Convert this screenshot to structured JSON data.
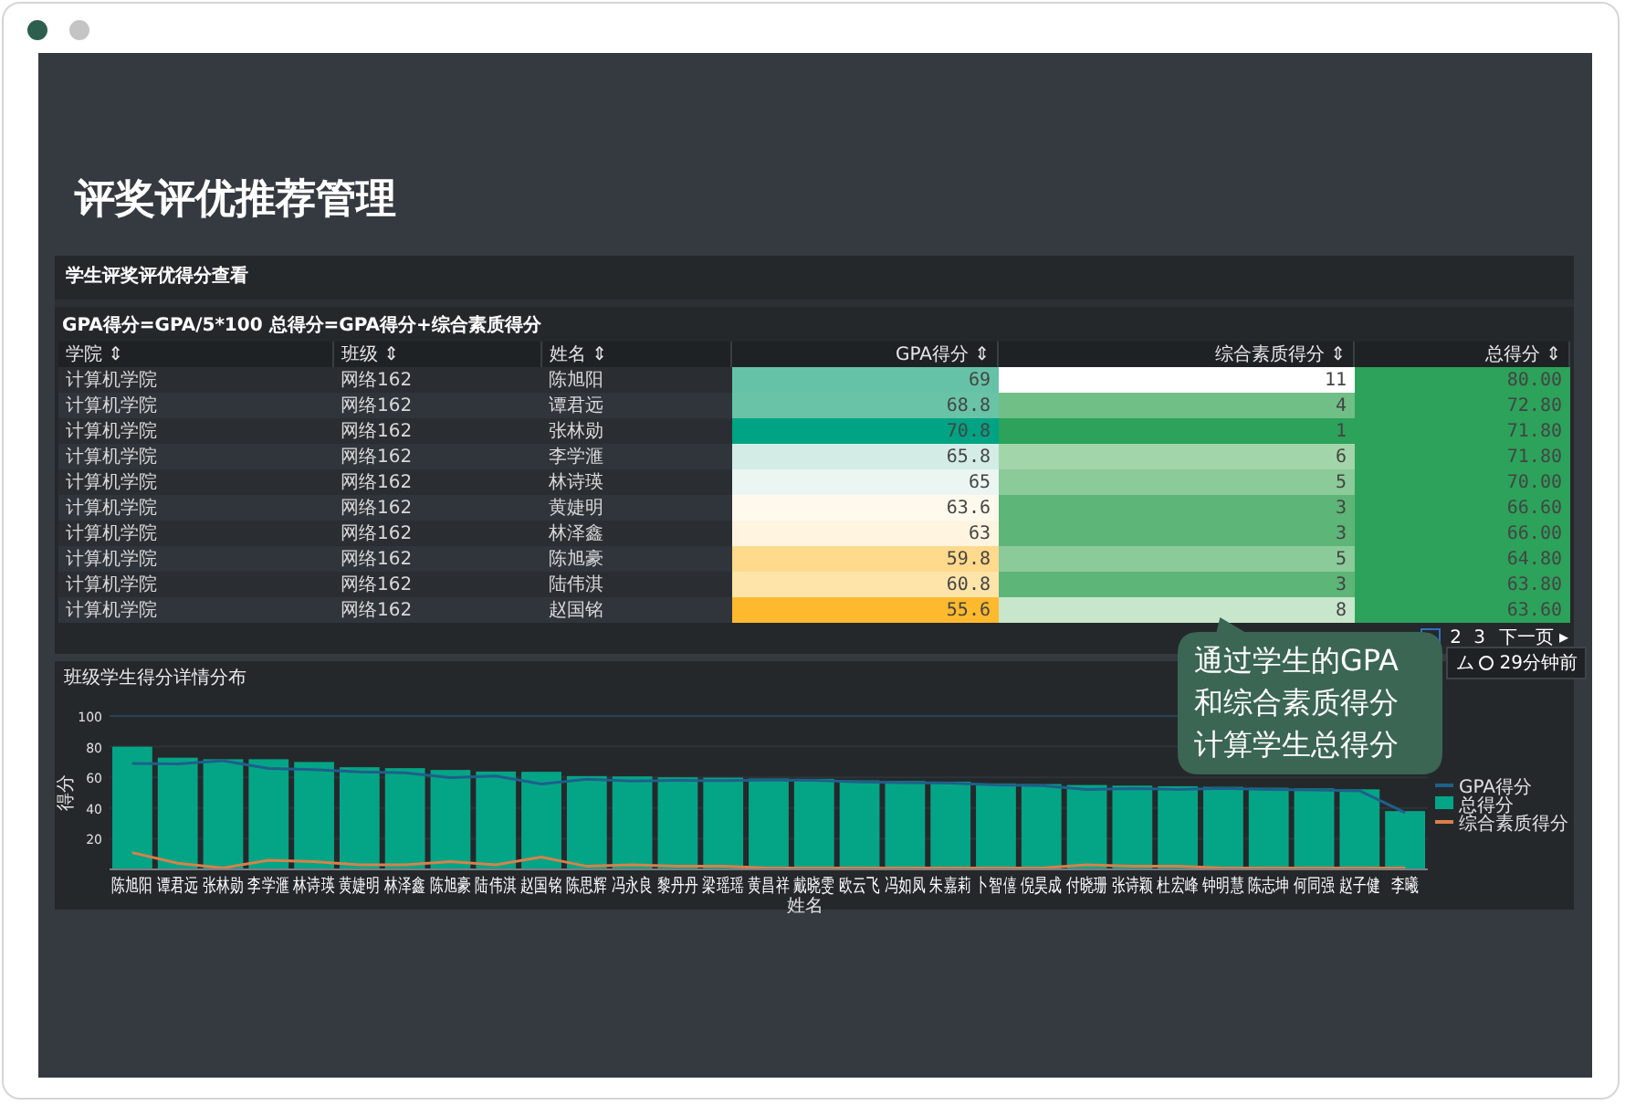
{
  "window": {
    "dots": [
      {
        "color": "#2e5e4e"
      },
      {
        "color": "#c4c4c4"
      }
    ]
  },
  "page_title": "评奖评优推荐管理",
  "panel": {
    "title": "学生评奖评优得分查看",
    "formula": "GPA得分=GPA/5*100 总得分=GPA得分+综合素质得分",
    "table": {
      "columns": [
        "学院 ⇕",
        "班级 ⇕",
        "姓名 ⇕",
        "GPA得分 ⇕",
        "综合素质得分 ⇕",
        "总得分 ⇕"
      ],
      "rows": [
        [
          {
            "text": "计算机学院"
          },
          {
            "text": "网络162"
          },
          {
            "text": "陈旭阳"
          },
          {
            "text": "69",
            "color": "#66c2a6"
          },
          {
            "text": "11",
            "color": "#ffffff"
          },
          {
            "text": "80.00",
            "color": "#2ca25a"
          }
        ],
        [
          {
            "text": "计算机学院"
          },
          {
            "text": "网络162"
          },
          {
            "text": "谭君远"
          },
          {
            "text": "68.8",
            "color": "#68c3a7"
          },
          {
            "text": "4",
            "color": "#70bf86"
          },
          {
            "text": "72.80",
            "color": "#2ca25a"
          }
        ],
        [
          {
            "text": "计算机学院"
          },
          {
            "text": "网络162"
          },
          {
            "text": "张林勋"
          },
          {
            "text": "70.8",
            "color": "#00a383"
          },
          {
            "text": "1",
            "color": "#2ca25a"
          },
          {
            "text": "71.80",
            "color": "#2ca25a"
          }
        ],
        [
          {
            "text": "计算机学院"
          },
          {
            "text": "网络162"
          },
          {
            "text": "李学滙"
          },
          {
            "text": "65.8",
            "color": "#d3ede6"
          },
          {
            "text": "6",
            "color": "#a3d5aa"
          },
          {
            "text": "71.80",
            "color": "#2ca25a"
          }
        ],
        [
          {
            "text": "计算机学院"
          },
          {
            "text": "网络162"
          },
          {
            "text": "林诗瑛"
          },
          {
            "text": "65",
            "color": "#ebf6f2"
          },
          {
            "text": "5",
            "color": "#8bca99"
          },
          {
            "text": "70.00",
            "color": "#2ca25a"
          }
        ],
        [
          {
            "text": "计算机学院"
          },
          {
            "text": "网络162"
          },
          {
            "text": "黄婕明"
          },
          {
            "text": "63.6",
            "color": "#fff9ed"
          },
          {
            "text": "3",
            "color": "#5db577"
          },
          {
            "text": "66.60",
            "color": "#2ca25a"
          }
        ],
        [
          {
            "text": "计算机学院"
          },
          {
            "text": "网络162"
          },
          {
            "text": "林泽鑫"
          },
          {
            "text": "63",
            "color": "#fff4e0"
          },
          {
            "text": "3",
            "color": "#5db577"
          },
          {
            "text": "66.00",
            "color": "#2ca25a"
          }
        ],
        [
          {
            "text": "计算机学院"
          },
          {
            "text": "网络162"
          },
          {
            "text": "陈旭豪"
          },
          {
            "text": "59.8",
            "color": "#ffd98c"
          },
          {
            "text": "5",
            "color": "#8bca99"
          },
          {
            "text": "64.80",
            "color": "#2ca25a"
          }
        ],
        [
          {
            "text": "计算机学院"
          },
          {
            "text": "网络162"
          },
          {
            "text": "陆伟淇"
          },
          {
            "text": "60.8",
            "color": "#ffe4aa"
          },
          {
            "text": "3",
            "color": "#5db577"
          },
          {
            "text": "63.80",
            "color": "#2ca25a"
          }
        ],
        [
          {
            "text": "计算机学院"
          },
          {
            "text": "网络162"
          },
          {
            "text": "赵国铭"
          },
          {
            "text": "55.6",
            "color": "#ffb92e"
          },
          {
            "text": "8",
            "color": "#c8e6cc"
          },
          {
            "text": "63.60",
            "color": "#2ca25a"
          }
        ]
      ]
    },
    "pagination": {
      "pages": [
        {
          "selected": true
        },
        {
          "label": "2",
          "selected": false
        },
        {
          "label": "3",
          "selected": false
        }
      ],
      "next": "下一页 ▸"
    },
    "refresh": {
      "icon_text": "ム",
      "text": "29分钟前"
    }
  },
  "chart_panel": {
    "title": "班级学生得分详情分布",
    "chart_data": {
      "type": "bar",
      "stacked": false,
      "grid": true,
      "legend": true,
      "xlabel": "姓名",
      "ylabel": "得分",
      "ylim": [
        0,
        100
      ],
      "yticks": [
        20,
        40,
        60,
        80,
        100
      ],
      "categories": [
        "陈旭阳",
        "谭君远",
        "张林勋",
        "李学滙",
        "林诗瑛",
        "黄婕明",
        "林泽鑫",
        "陈旭豪",
        "陆伟淇",
        "赵国铭",
        "陈思辉",
        "冯永良",
        "黎丹丹",
        "梁瑶瑶",
        "黄昌祥",
        "戴晓雯",
        "欧云飞",
        "冯如凤",
        "朱嘉莉",
        "卜智僖",
        "倪昊成",
        "付晓珊",
        "张诗颖",
        "杜宏峰",
        "钟明慧",
        "陈志坤",
        "何同强",
        "赵子健",
        "李曦"
      ],
      "series": [
        {
          "name": "GPA得分",
          "type": "line",
          "color": "#1f5f8b",
          "values": [
            69,
            68.8,
            70.8,
            65.8,
            65,
            63.6,
            63,
            59.8,
            60.8,
            55.6,
            58.8,
            57.6,
            58,
            57.8,
            58.2,
            58,
            57,
            56.6,
            56.2,
            55,
            54.6,
            52,
            52.6,
            52.2,
            52.8,
            52.2,
            51.8,
            51.2,
            37
          ]
        },
        {
          "name": "总得分",
          "color": "#04a586",
          "values": [
            80,
            72.8,
            71.8,
            71.8,
            70,
            66.6,
            66,
            64.8,
            63.8,
            63.6,
            60.8,
            60.6,
            60,
            59.8,
            59.2,
            59,
            58,
            57.6,
            57.2,
            56,
            55.6,
            55,
            54.6,
            54.2,
            53.8,
            53.2,
            52.8,
            52.2,
            38
          ]
        },
        {
          "name": "综合素质得分",
          "type": "line",
          "color": "#d9804a",
          "values": [
            11,
            4,
            1,
            6,
            5,
            3,
            3,
            5,
            3,
            8,
            2,
            3,
            2,
            2,
            1,
            1,
            1,
            1,
            1,
            1,
            1,
            3,
            2,
            2,
            1,
            1,
            1,
            1,
            1
          ]
        }
      ]
    }
  },
  "callout": {
    "lines": [
      "通过学生的GPA",
      "和综合素质得分",
      "计算学生总得分"
    ]
  }
}
